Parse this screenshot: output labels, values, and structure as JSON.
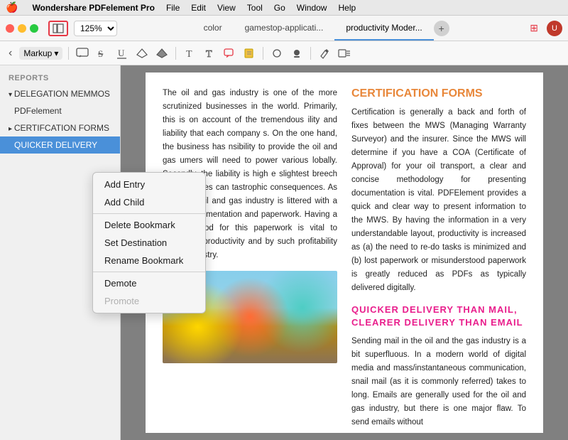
{
  "menubar": {
    "apple": "🍎",
    "items": [
      "Wondershare PDFelement Pro",
      "File",
      "Edit",
      "View",
      "Tool",
      "Go",
      "Window",
      "Help"
    ]
  },
  "toolbar": {
    "zoom": "125%",
    "tabs": [
      {
        "label": "color",
        "active": false
      },
      {
        "label": "gamestop-applicati...",
        "active": false
      },
      {
        "label": "productivity Moder...",
        "active": true
      }
    ],
    "add_tab": "+",
    "panel_icon": "⊞"
  },
  "markup_bar": {
    "nav_back": "‹",
    "nav_fwd": "›",
    "markup_label": "Markup",
    "tools": [
      "🗨",
      "S̶",
      "U̲",
      "◇",
      "◈",
      "T",
      "T",
      "▣",
      "●",
      "⬤",
      "♟",
      "🖊"
    ]
  },
  "sidebar": {
    "sections": [
      {
        "label": "REPORTS",
        "type": "section"
      },
      {
        "label": "DELEGATION MEMMOS",
        "type": "group",
        "expanded": true,
        "children": [
          {
            "label": "PDFelement",
            "type": "item"
          }
        ]
      },
      {
        "label": "CERTIFCATION FORMS",
        "type": "group",
        "expanded": false
      },
      {
        "label": "QUICKER DELIVERY",
        "type": "item",
        "active": true
      }
    ]
  },
  "context_menu": {
    "items": [
      {
        "label": "Add Entry",
        "disabled": false
      },
      {
        "label": "Add Child",
        "disabled": false
      },
      {
        "label": "Delete Bookmark",
        "disabled": false
      },
      {
        "label": "Set Destination",
        "disabled": false
      },
      {
        "label": "Rename Bookmark",
        "disabled": false
      },
      {
        "label": "Demote",
        "disabled": false
      },
      {
        "label": "Promote",
        "disabled": true
      }
    ],
    "separators": [
      1,
      4
    ]
  },
  "pdf": {
    "left_col": {
      "body": "The oil and gas industry is one of the more scrutinized businesses in the world. Primarily, this is on account of the tremendous ility and liability that each company s. On the one hand, the business has nsibility to provide the oil and gas umers will need to power various lobally. Secondly, the liability is high e slightest breech in procedures can tastrophic consequences. As such, the oil and gas industry is littered with a sea of documentation and paperwork. Having a clear method for this paperwork is vital to increasing productivity and by such profitability for the industry."
    },
    "right_col": {
      "heading": "CERTIFICATION FORMS",
      "body1": "Certification is generally a back and forth of fixes between the MWS (Managing Warranty Surveyor) and the insurer. Since the MWS will determine if you have a COA (Certificate of Approval) for your oil transport, a clear and concise methodology for presenting documentation is vital. PDFElement provides a quick and clear way to present information to the MWS. By having the information in a very understandable layout, productivity is increased as (a) the need to re-do tasks is minimized and (b) lost paperwork or misunderstood paperwork is greatly reduced as PDFs as typically delivered digitally.",
      "subheading": "QUICKER DELIVERY THAN MAIL, CLEARER DELIVERY THAN EMAIL",
      "body2": "Sending mail in the oil and the gas industry is a bit superfluous. In a modern world of digital media and mass/instantaneous communication, snail mail (as it is commonly referred) takes to long. Emails are generally used for the oil and gas industry, but there is one major flaw. To send emails without"
    }
  }
}
